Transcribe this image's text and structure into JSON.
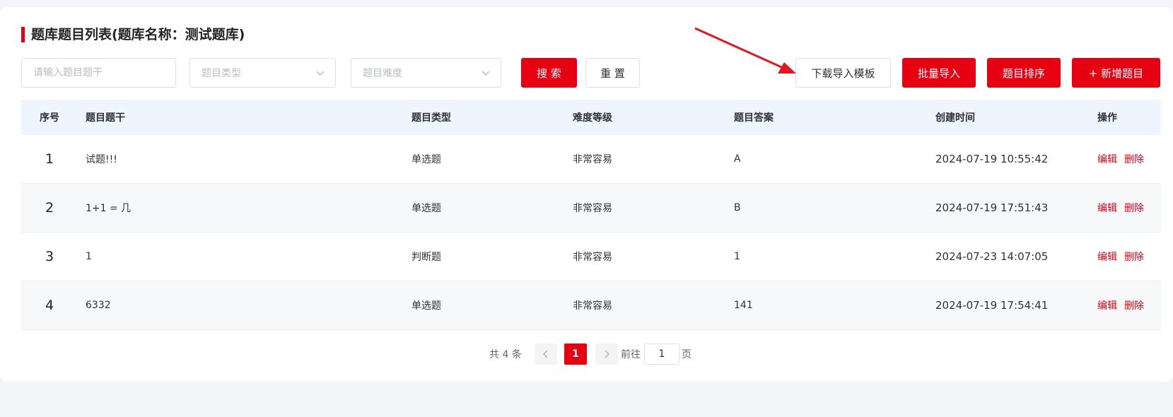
{
  "page": {
    "title": "题库题目列表(题库名称：测试题库)"
  },
  "filters": {
    "stem_placeholder": "请输入题目题干",
    "type_placeholder": "题目类型",
    "difficulty_placeholder": "题目难度",
    "search_label": "搜 索",
    "reset_label": "重 置"
  },
  "actions": {
    "download_template": "下载导入模板",
    "batch_import": "批量导入",
    "sort_questions": "题目排序",
    "add_question": "+ 新增题目"
  },
  "table": {
    "headers": {
      "index": "序号",
      "stem": "题目题干",
      "type": "题目类型",
      "difficulty": "难度等级",
      "answer": "题目答案",
      "created": "创建时间",
      "ops": "操作"
    },
    "rows": [
      {
        "index": "1",
        "stem": "试题!!!",
        "type": "单选题",
        "difficulty": "非常容易",
        "answer": "A",
        "created": "2024-07-19 10:55:42",
        "edit": "编辑",
        "delete": "删除"
      },
      {
        "index": "2",
        "stem": "1+1 = 几",
        "type": "单选题",
        "difficulty": "非常容易",
        "answer": "B",
        "created": "2024-07-19 17:51:43",
        "edit": "编辑",
        "delete": "删除"
      },
      {
        "index": "3",
        "stem": "1",
        "type": "判断题",
        "difficulty": "非常容易",
        "answer": "1",
        "created": "2024-07-23 14:07:05",
        "edit": "编辑",
        "delete": "删除"
      },
      {
        "index": "4",
        "stem": "6332",
        "type": "单选题",
        "difficulty": "非常容易",
        "answer": "141",
        "created": "2024-07-19 17:54:41",
        "edit": "编辑",
        "delete": "删除"
      }
    ]
  },
  "pagination": {
    "total_text": "共 4 条",
    "current_page": "1",
    "goto_label": "前往",
    "goto_value": "1",
    "page_suffix": "页"
  },
  "colors": {
    "accent": "#e60012",
    "annotation_arrow": "#e8141e"
  }
}
